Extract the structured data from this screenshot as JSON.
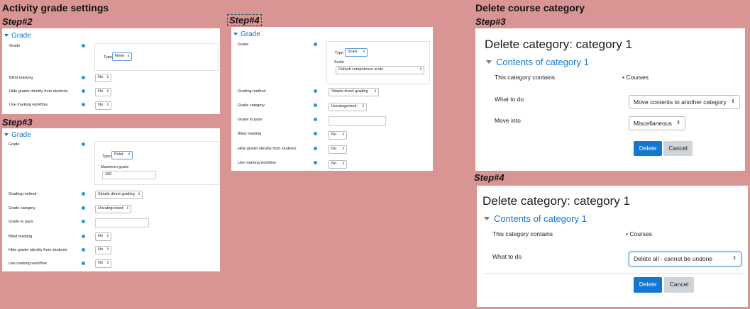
{
  "left_heading": "Activity grade settings",
  "right_heading": "Delete course category",
  "steps": {
    "s2": "Step#2",
    "s3": "Step#3",
    "s4": "Step#4"
  },
  "grade_panel": {
    "section_title": "Grade",
    "grade_label": "Grade",
    "type_label": "Type",
    "type_none": "None",
    "type_point": "Point",
    "type_scale": "Scale",
    "max_grade_label": "Maximum grade",
    "max_grade_value": "100",
    "scale_label": "Scale",
    "scale_value": "Default competence scale",
    "grading_method_label": "Grading method",
    "grading_method_value": "Simple direct grading",
    "grade_category_label": "Grade category",
    "grade_category_value": "Uncategorised",
    "grade_to_pass_label": "Grade to pass",
    "blind_marking_label": "Blind marking",
    "hide_grader_label": "Hide grader identity from students",
    "marking_workflow_label": "Use marking workflow",
    "no_value": "No"
  },
  "delete_panel": {
    "title": "Delete category: category 1",
    "section": "Contents of category 1",
    "contains_label": "This category contains",
    "contains_value": "Courses",
    "what_to_do_label": "What to do",
    "move_option": "Move contents to another category",
    "delete_all_option": "Delete all - cannot be undone",
    "move_into_label": "Move into",
    "move_into_value": "Miscellaneous",
    "delete_button": "Delete",
    "cancel_button": "Cancel"
  },
  "colors": {
    "background": "#d99594",
    "link_blue": "#1177d1",
    "primary_button": "#1177d1",
    "help_icon": "#1d9bd1"
  }
}
